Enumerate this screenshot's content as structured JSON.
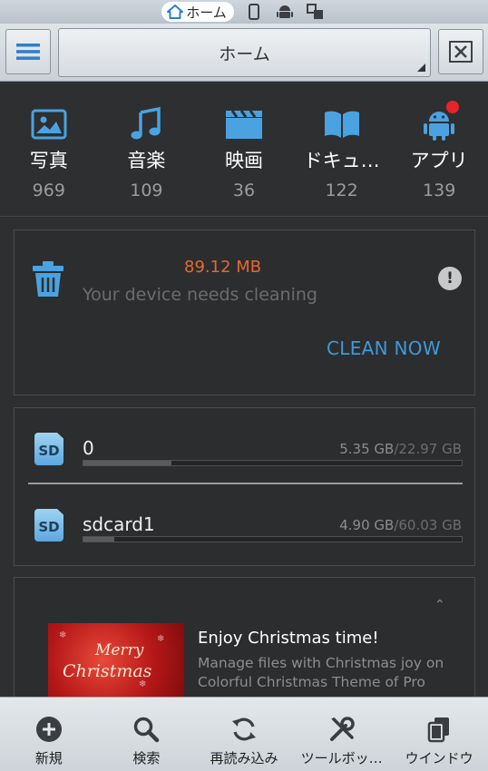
{
  "top_strip": {
    "home_tab_label": "ホーム",
    "icons": [
      "home-icon",
      "phone-icon",
      "android-icon",
      "devices-icon"
    ]
  },
  "toolbar": {
    "title": "ホーム",
    "menu_icon": "hamburger-menu-icon",
    "close_icon": "close-x-icon"
  },
  "categories": [
    {
      "label": "写真",
      "count": "969",
      "icon": "image-icon"
    },
    {
      "label": "音楽",
      "count": "109",
      "icon": "music-note-icon"
    },
    {
      "label": "映画",
      "count": "36",
      "icon": "film-clapper-icon"
    },
    {
      "label": "ドキュ…",
      "count": "122",
      "icon": "book-icon"
    },
    {
      "label": "アプリ",
      "count": "139",
      "icon": "android-app-icon"
    }
  ],
  "cleaner": {
    "size": "89.12 MB",
    "message": "Your device needs cleaning",
    "action": "CLEAN NOW",
    "colors": {
      "size": "#e4692f",
      "action": "#3d9ad9"
    }
  },
  "storage": [
    {
      "badge": "SD",
      "name": "0",
      "used": "5.35 GB",
      "total": "/22.97 GB",
      "used_fraction": 0.233
    },
    {
      "badge": "SD",
      "name": "sdcard1",
      "used": "4.90 GB",
      "total": "/60.03 GB",
      "used_fraction": 0.082
    }
  ],
  "promo": {
    "title": "Enjoy Christmas time!",
    "description": "Manage files with Christmas joy on Colorful Christmas Theme of Pro",
    "image_text_line1": "Merry",
    "image_text_line2": "Christmas"
  },
  "bottom_bar": [
    {
      "label": "新規",
      "icon": "plus-circle-icon"
    },
    {
      "label": "検索",
      "icon": "search-icon"
    },
    {
      "label": "再読み込み",
      "icon": "refresh-icon"
    },
    {
      "label": "ツールボッ…",
      "icon": "tools-icon"
    },
    {
      "label": "ウインドウ",
      "icon": "windows-icon"
    }
  ]
}
